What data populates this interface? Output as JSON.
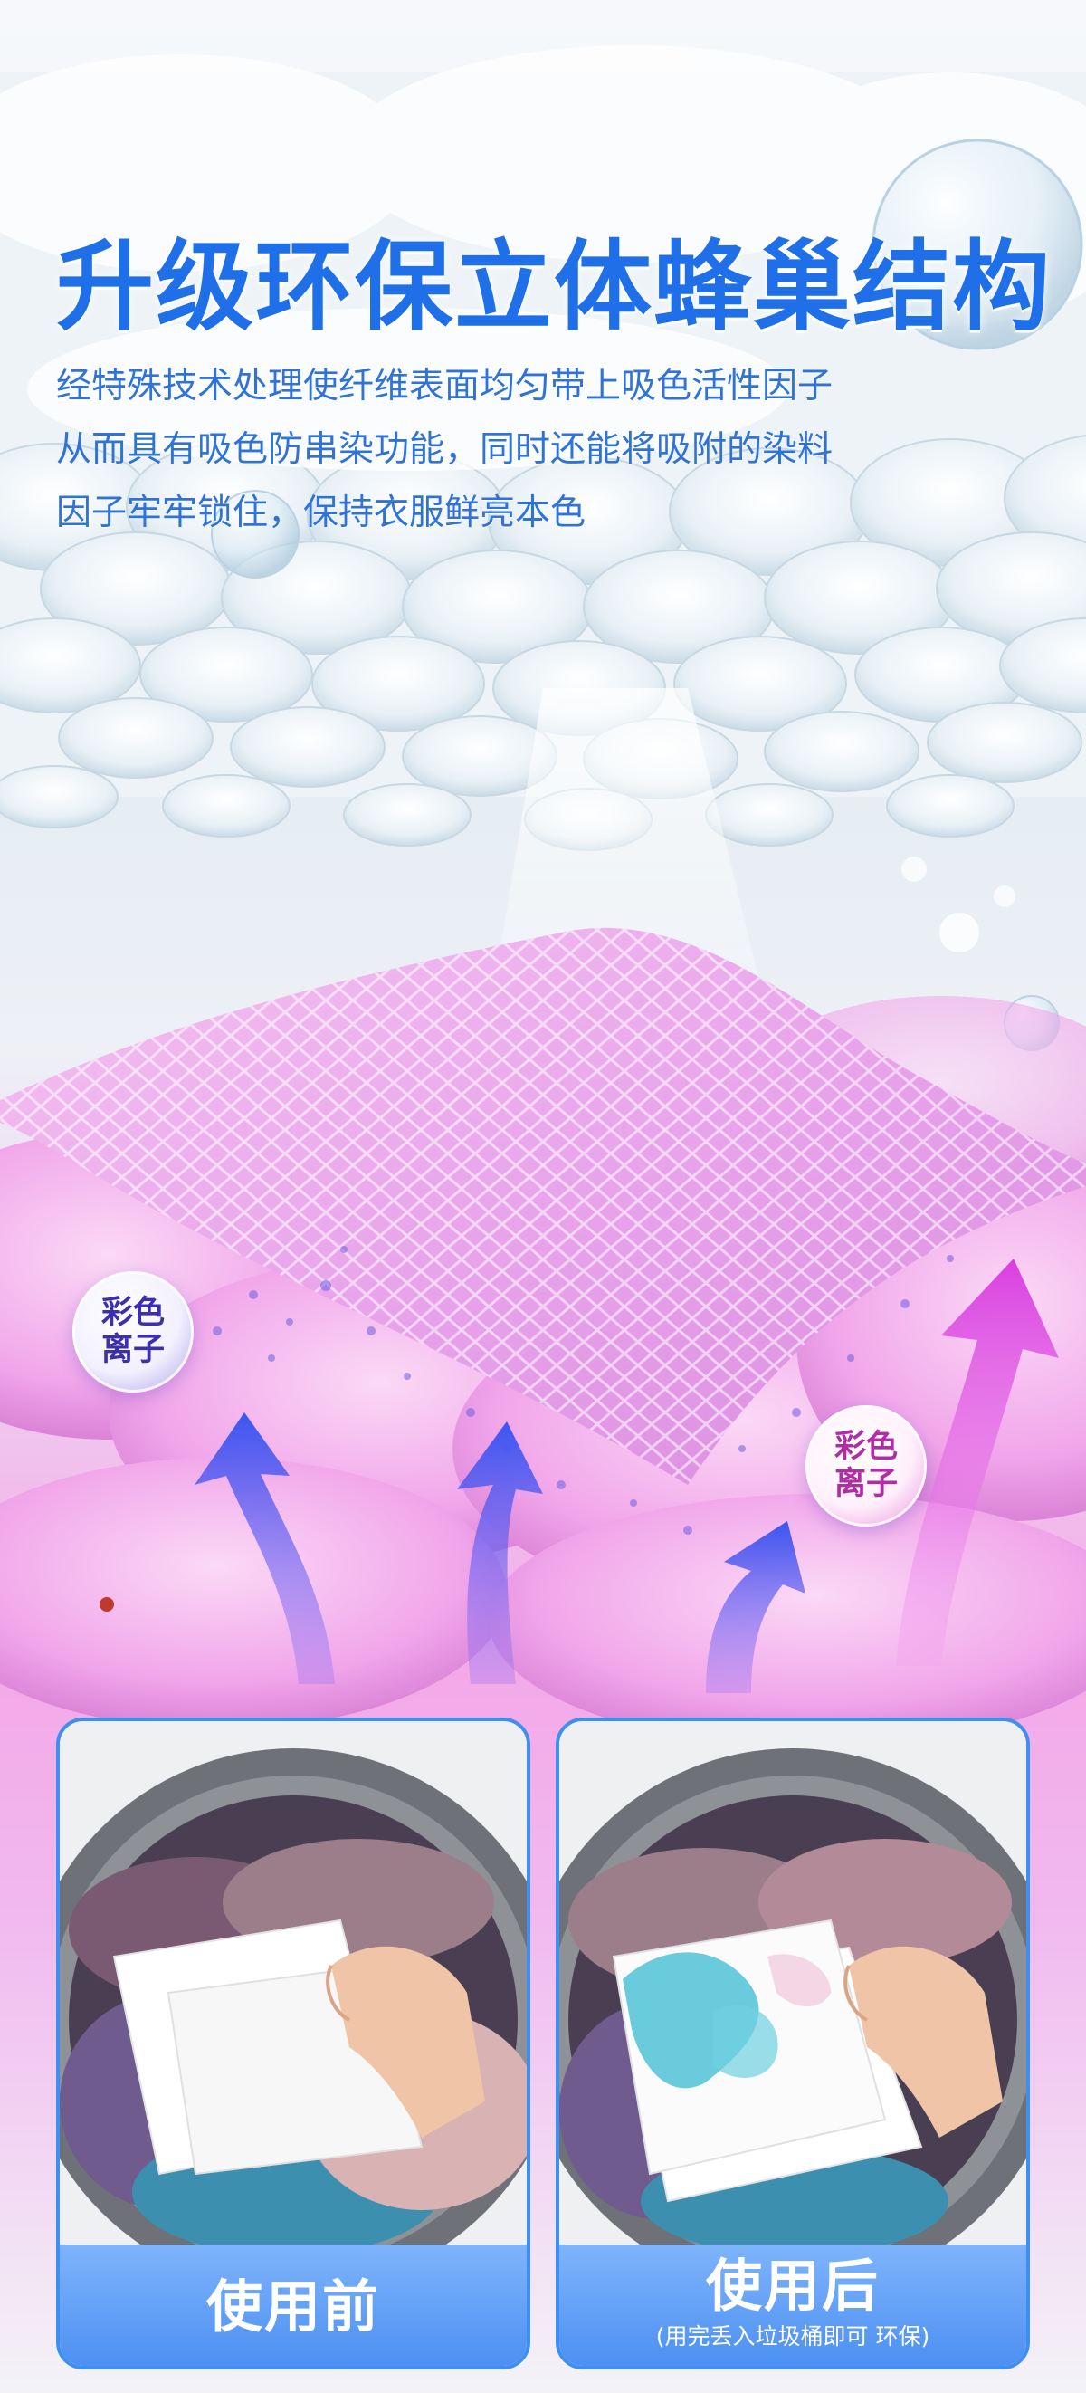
{
  "headline": "升级环保立体蜂巢结构",
  "description_lines": [
    "经特殊技术处理使纤维表面均匀带上吸色活性因子",
    "从而具有吸色防串染功能，同时还能将吸附的染料",
    "因子牢牢锁住，保持衣服鲜亮本色"
  ],
  "badges": {
    "left": {
      "line1": "彩色",
      "line2": "离子"
    },
    "right": {
      "line1": "彩色",
      "line2": "离子"
    }
  },
  "comparison": {
    "before": {
      "label": "使用前"
    },
    "after": {
      "label": "使用后",
      "note": "(用完丢入垃圾桶即可 环保)"
    }
  },
  "colors": {
    "title": "#1f6fe8",
    "description": "#2f73d8",
    "card_border": "#3f8ff0",
    "label_bar": "#4b8ff2",
    "sheet_pink": "#e79be8",
    "arrow_blue": "#4a5cf0",
    "arrow_magenta": "#e04fe0"
  },
  "icons": [
    "water-drop-icon",
    "arrow-up-icon"
  ]
}
